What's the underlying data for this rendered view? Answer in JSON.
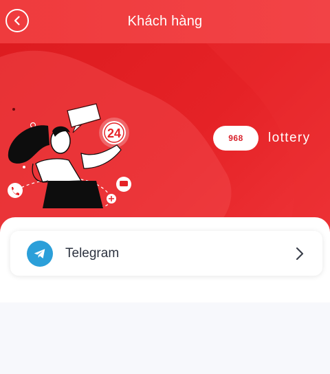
{
  "header": {
    "title": "Khách hàng",
    "back_icon": "chevron-left-circle-icon"
  },
  "banner": {
    "badge_number": "24",
    "brand_number": "968",
    "brand_name": "lottery",
    "colors": {
      "primary_red": "#e52226",
      "header_red": "#ef3b3d",
      "light_red": "#f6474a"
    }
  },
  "contacts": [
    {
      "label": "Telegram",
      "icon": "telegram-icon",
      "trailing_icon": "chevron-right-icon",
      "icon_color": "#2b9fd9"
    }
  ]
}
